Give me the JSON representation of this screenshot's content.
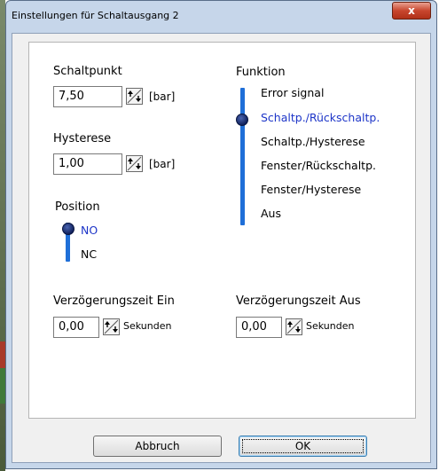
{
  "window": {
    "title": "Einstellungen für Schaltausgang 2",
    "close_glyph": "x"
  },
  "schaltpunkt": {
    "label": "Schaltpunkt",
    "value": "7,50",
    "unit": "[bar]"
  },
  "hysterese": {
    "label": "Hysterese",
    "value": "1,00",
    "unit": "[bar]"
  },
  "position": {
    "label": "Position",
    "options": [
      "NO",
      "NC"
    ],
    "selected_index": 0
  },
  "funktion": {
    "label": "Funktion",
    "options": [
      "Error signal",
      "Schaltp./Rückschaltp.",
      "Schaltp./Hysterese",
      "Fenster/Rückschaltp.",
      "Fenster/Hysterese",
      "Aus"
    ],
    "selected_index": 1
  },
  "delay_on": {
    "label": "Verzögerungszeit Ein",
    "value": "0,00",
    "unit": "Sekunden"
  },
  "delay_off": {
    "label": "Verzögerungszeit Aus",
    "value": "0,00",
    "unit": "Sekunden"
  },
  "buttons": {
    "cancel": "Abbruch",
    "ok": "OK"
  },
  "colors": {
    "accent": "#1f6fd8",
    "selected_text": "#1d35c8",
    "knob": "#0e1e58",
    "close": "#c8462e"
  },
  "icons": {
    "spinner": "spin-arrows-icon",
    "close": "close-icon"
  }
}
